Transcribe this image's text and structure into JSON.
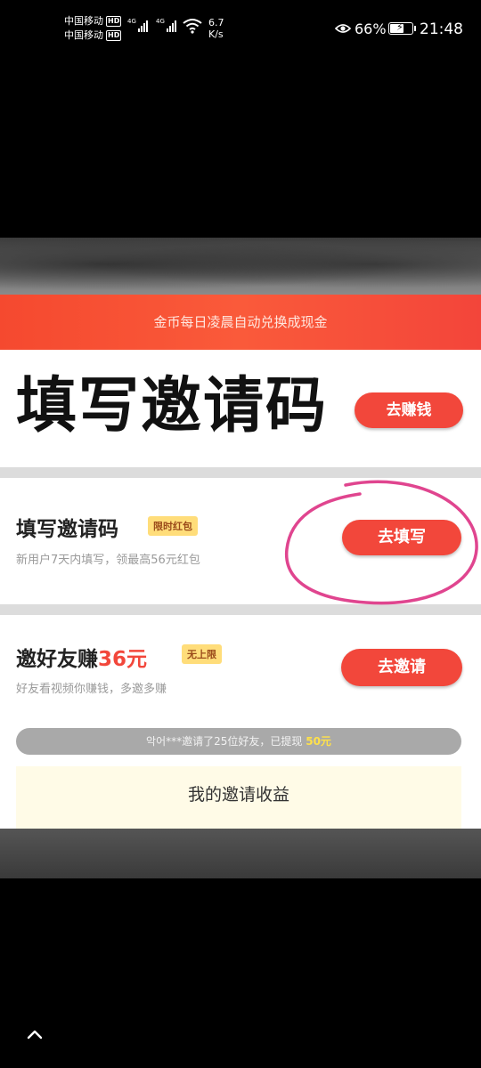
{
  "status_bar": {
    "carrier1": "中国移动",
    "carrier2": "中国移动",
    "hd_badge": "HD",
    "net1": "4G",
    "net2": "4G",
    "speed_value": "6.7",
    "speed_unit": "K/s",
    "battery_percent": "66%",
    "battery_level": 0.66,
    "time": "21:48"
  },
  "banner": {
    "text": "金币每日凌晨自动兑换成现金"
  },
  "hero": {
    "title": "填写邀请码",
    "button": "去赚钱"
  },
  "invite_code": {
    "title": "填写邀请码",
    "tag": "限时红包",
    "subtitle": "新用户7天内填写，领最高56元红包",
    "button": "去填写"
  },
  "invite_friends": {
    "title_prefix": "邀好友赚",
    "amount": "36元",
    "tag": "无上限",
    "subtitle": "好友看视频你赚钱，多邀多赚",
    "button": "去邀请"
  },
  "ticker": {
    "text": "악어***邀请了25位好友，已提现",
    "amount": "50元"
  },
  "earnings": {
    "label": "我的邀请收益"
  },
  "colors": {
    "accent": "#f2473b",
    "annotation": "#e0458f",
    "tag": "#ffdd7a"
  }
}
